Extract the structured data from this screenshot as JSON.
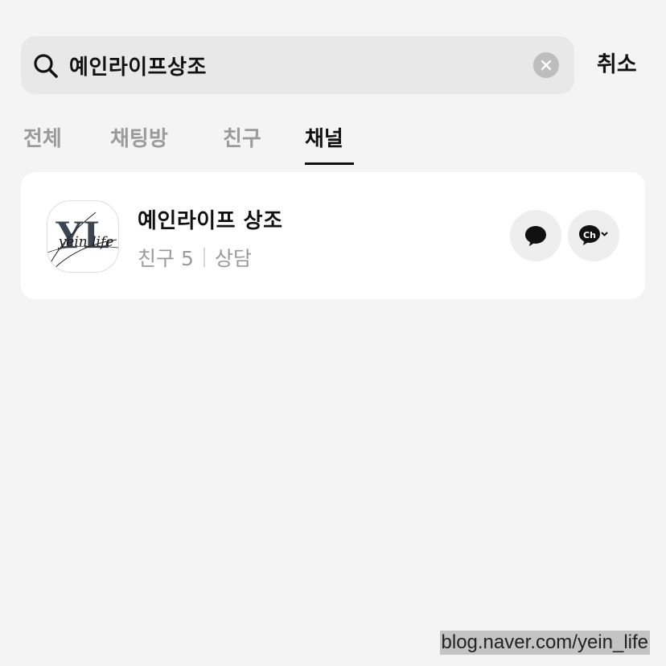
{
  "search": {
    "query": "예인라이프상조",
    "cancel_label": "취소"
  },
  "tabs": [
    {
      "label": "전체",
      "active": false
    },
    {
      "label": "채팅방",
      "active": false
    },
    {
      "label": "친구",
      "active": false
    },
    {
      "label": "채널",
      "active": true
    }
  ],
  "result": {
    "name": "예인라이프 상조",
    "friends_label": "친구 5",
    "category": "상담",
    "logo_text": "YL",
    "logo_script": "yein life"
  },
  "watermark": "blog.naver.com/yein_life",
  "colors": {
    "background": "#f4f4f4",
    "search_bg": "#e8e8e8",
    "inactive_tab": "#9b9b9b",
    "logo_color": "#3a4652"
  },
  "icons": {
    "search": "search-icon",
    "clear": "clear-circle-x-icon",
    "chat": "chat-bubble-icon",
    "channel": "channel-add-icon"
  }
}
